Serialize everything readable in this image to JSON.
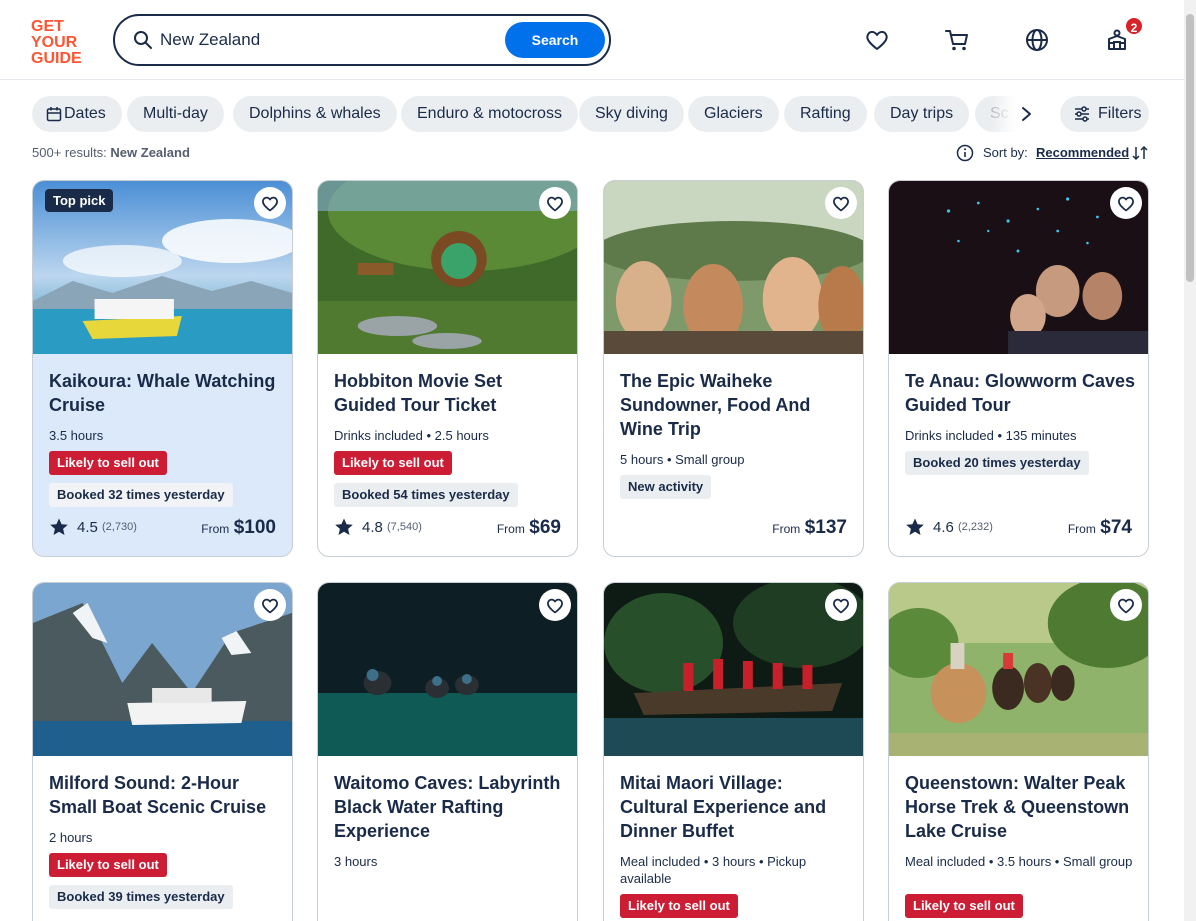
{
  "search": {
    "value": "New Zealand",
    "button": "Search"
  },
  "header": {
    "cart_count": "2"
  },
  "filters": {
    "chips": [
      "Dates",
      "Multi-day",
      "Dolphins & whales",
      "Enduro & motocross",
      "Sky diving",
      "Glaciers",
      "Rafting",
      "Day trips"
    ],
    "truncated_chip": "Sc",
    "filters_label": "Filters"
  },
  "results": {
    "count": "500+ results:",
    "query": "New Zealand"
  },
  "sort": {
    "label": "Sort by:",
    "value": "Recommended"
  },
  "cards": [
    {
      "badge": "Top pick",
      "title": "Kaikoura: Whale Watching Cruise",
      "meta": "3.5 hours",
      "red_tag": "Likely to sell out",
      "gray_tag": "Booked 32 times yesterday",
      "rating": "4.5",
      "reviews": "(2,730)",
      "from": "From",
      "price": "$100"
    },
    {
      "title": "Hobbiton Movie Set Guided Tour Ticket",
      "meta": "Drinks included • 2.5 hours",
      "red_tag": "Likely to sell out",
      "gray_tag": "Booked 54 times yesterday",
      "rating": "4.8",
      "reviews": "(7,540)",
      "from": "From",
      "price": "$69"
    },
    {
      "title": "The Epic Waiheke Sundowner, Food And Wine Trip",
      "meta": "5 hours • Small group",
      "gray_tag": "New activity",
      "from": "From",
      "price": "$137"
    },
    {
      "title": "Te Anau: Glowworm Caves Guided Tour",
      "meta": "Drinks included • 135 minutes",
      "gray_tag": "Booked 20 times yesterday",
      "rating": "4.6",
      "reviews": "(2,232)",
      "from": "From",
      "price": "$74"
    },
    {
      "title": "Milford Sound: 2-Hour Small Boat Scenic Cruise",
      "meta": "2 hours",
      "red_tag": "Likely to sell out",
      "gray_tag": "Booked 39 times yesterday"
    },
    {
      "title": "Waitomo Caves: Labyrinth Black Water Rafting Experience",
      "meta": "3 hours"
    },
    {
      "title": "Mitai Maori Village: Cultural Experience and Dinner Buffet",
      "meta": "Meal included • 3 hours • Pickup available",
      "red_tag": "Likely to sell out"
    },
    {
      "title": "Queenstown: Walter Peak Horse Trek & Queenstown Lake Cruise",
      "meta": "Meal included • 3.5 hours • Small group",
      "red_tag": "Likely to sell out"
    }
  ]
}
